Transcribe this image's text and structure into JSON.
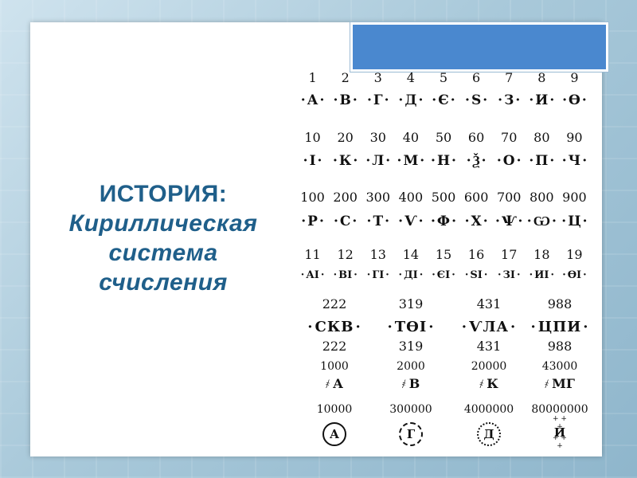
{
  "title": {
    "line1": "ИСТОРИЯ:",
    "line2": "Кириллическая",
    "line3": "система",
    "line4": "счисления"
  },
  "units_row": {
    "numbers": [
      "1",
      "2",
      "3",
      "4",
      "5",
      "6",
      "7",
      "8",
      "9"
    ],
    "letters": [
      "А",
      "В",
      "Г",
      "Д",
      "Є",
      "S",
      "З",
      "И",
      "Ѳ"
    ]
  },
  "tens_row": {
    "numbers": [
      "10",
      "20",
      "30",
      "40",
      "50",
      "60",
      "70",
      "80",
      "90"
    ],
    "letters": [
      "І",
      "К",
      "Л",
      "М",
      "Н",
      "Ѯ",
      "О",
      "П",
      "Ч"
    ]
  },
  "hundreds_row": {
    "numbers": [
      "100",
      "200",
      "300",
      "400",
      "500",
      "600",
      "700",
      "800",
      "900"
    ],
    "letters": [
      "Р",
      "С",
      "Т",
      "Ѵ",
      "Ф",
      "Х",
      "Ѱ",
      "Ѡ",
      "Ц"
    ]
  },
  "teens_row": {
    "numbers": [
      "11",
      "12",
      "13",
      "14",
      "15",
      "16",
      "17",
      "18",
      "19"
    ],
    "letters": [
      "АІ",
      "ВІ",
      "ГІ",
      "ДІ",
      "ЄІ",
      "SІ",
      "ЗІ",
      "ИІ",
      "ѲІ"
    ]
  },
  "compound_row": {
    "numbers_top": [
      "222",
      "319",
      "431",
      "988"
    ],
    "letters": [
      "СКВ",
      "ТѲІ",
      "ѴЛА",
      "ЦПИ"
    ],
    "numbers_bottom": [
      "222",
      "319",
      "431",
      "988"
    ]
  },
  "thousands_row": {
    "numbers": [
      "1000",
      "2000",
      "20000",
      "43000"
    ],
    "letters": [
      "А",
      "В",
      "К",
      "МГ"
    ]
  },
  "large_row": {
    "numbers": [
      "10000",
      "300000",
      "4000000",
      "80000000"
    ],
    "letters": [
      "А",
      "Г",
      "Д",
      "И"
    ]
  },
  "symbols": {
    "titlo": "︵",
    "thousand_sign": "҂"
  }
}
